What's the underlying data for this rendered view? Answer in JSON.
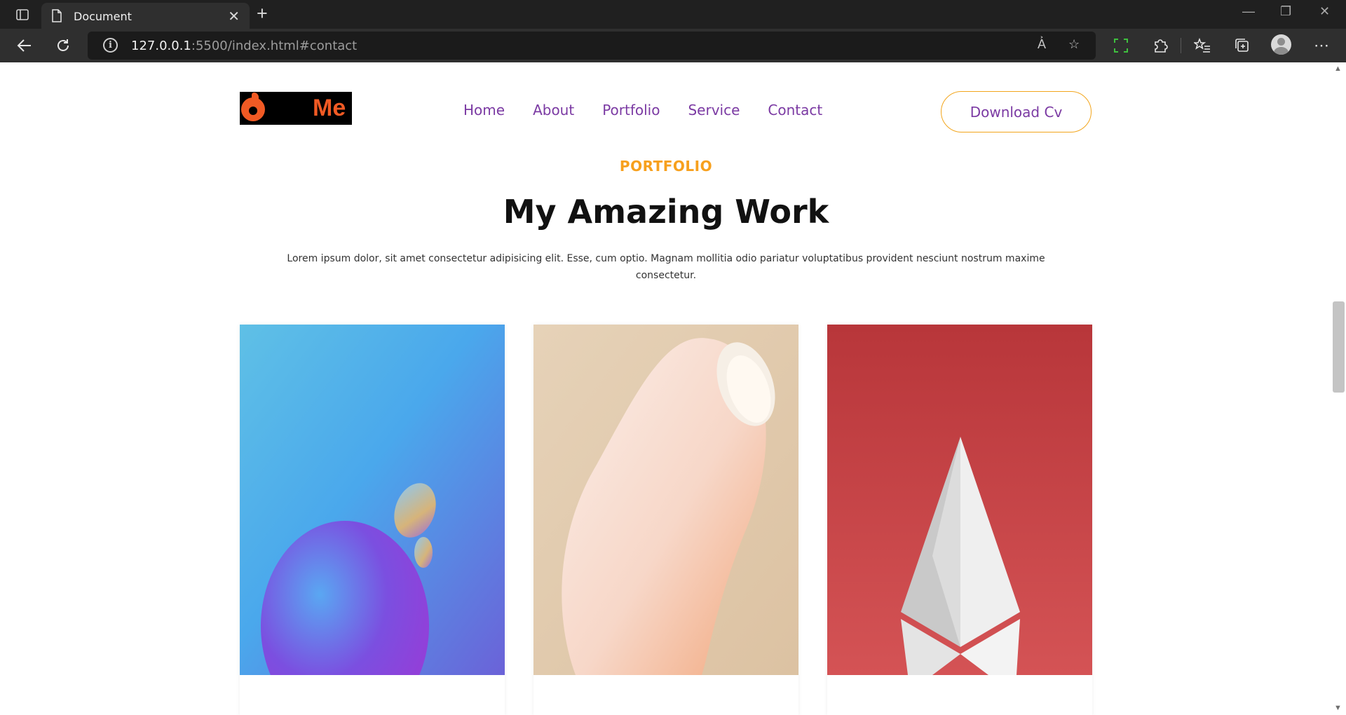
{
  "browser": {
    "tab_title": "Document",
    "url_host": "127.0.0.1",
    "url_rest": ":5500/index.html#contact"
  },
  "site": {
    "logo_text": "Me",
    "nav": [
      "Home",
      "About",
      "Portfolio",
      "Service",
      "Contact"
    ],
    "cta_label": "Download Cv"
  },
  "portfolio": {
    "eyebrow": "PORTFOLIO",
    "title": "My Amazing Work",
    "description": "Lorem ipsum dolor, sit amet consectetur adipisicing elit. Esse, cum optio. Magnam mollitia odio pariatur voluptatibus provident nesciunt nostrum maxime consectetur."
  },
  "colors": {
    "accent": "#f7a01d",
    "nav": "#7b3aa3",
    "logo": "#f15a24"
  },
  "icons": {
    "tab_actions": "tab-actions-icon",
    "tab_doc": "document-icon",
    "close": "close-icon",
    "new_tab": "plus-icon",
    "back": "back-arrow-icon",
    "reload": "reload-icon",
    "info": "info-icon",
    "read_aloud": "read-aloud-icon",
    "favorite_add": "star-plus-icon",
    "screenshot": "screenshot-icon",
    "extensions": "puzzle-icon",
    "favorites": "favorites-icon",
    "collections": "collections-icon",
    "profile": "avatar",
    "more": "more-icon"
  }
}
